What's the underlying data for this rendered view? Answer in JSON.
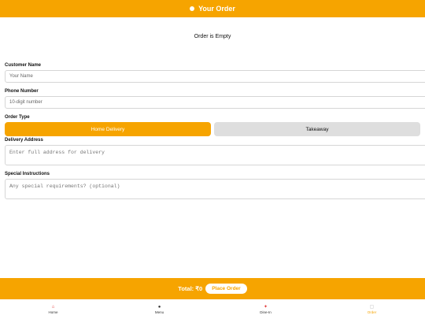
{
  "colors": {
    "accent": "#f6a400",
    "text": "#111111",
    "muted": "#777777",
    "inactive_bg": "#dedede"
  },
  "header": {
    "title": "Your Order"
  },
  "order": {
    "empty_message": "Order is Empty"
  },
  "form": {
    "customer_name": {
      "label": "Customer Name",
      "placeholder": "Your Name"
    },
    "phone": {
      "label": "Phone Number",
      "placeholder": "10-digit number"
    },
    "order_type": {
      "label": "Order Type",
      "options": [
        "Home Delivery",
        "Takeaway"
      ],
      "selected": "Home Delivery"
    },
    "address": {
      "label": "Delivery Address",
      "placeholder": "Enter full address for delivery"
    },
    "instructions": {
      "label": "Special Instructions",
      "placeholder": "Any special requirements? (optional)"
    }
  },
  "footer": {
    "total_label": "Total: ₹0",
    "place_order_label": "Place Order"
  },
  "nav": {
    "items": [
      {
        "label": "Home",
        "icon": "home-icon"
      },
      {
        "label": "Menu",
        "icon": "menu-icon"
      },
      {
        "label": "Dine-In",
        "icon": "dine-in-icon"
      },
      {
        "label": "Order",
        "icon": "order-icon"
      }
    ],
    "active": "Order"
  }
}
